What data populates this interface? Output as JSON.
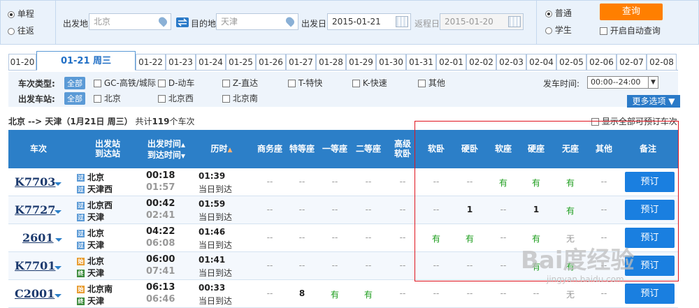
{
  "search": {
    "trip_types": [
      "单程",
      "往返"
    ],
    "from_label": "出发地",
    "from_value": "北京",
    "to_label": "目的地",
    "to_value": "天津",
    "depart_label": "出发日",
    "depart_value": "2015-01-21",
    "return_label": "返程日",
    "return_value": "2015-01-20",
    "passenger_types": [
      "普通",
      "学生"
    ],
    "query_label": "查询",
    "auto_query_label": "开启自动查询"
  },
  "date_tabs": [
    "01-20",
    "01-21 周三",
    "01-22",
    "01-23",
    "01-24",
    "01-25",
    "01-26",
    "01-27",
    "01-28",
    "01-29",
    "01-30",
    "01-31",
    "02-01",
    "02-02",
    "02-03",
    "02-04",
    "02-05",
    "02-06",
    "02-07",
    "02-08"
  ],
  "filters": {
    "type_label": "车次类型:",
    "all_label": "全部",
    "types": [
      "GC-高铁/城际",
      "D-动车",
      "Z-直达",
      "T-特快",
      "K-快速",
      "其他"
    ],
    "station_label": "出发车站:",
    "stations": [
      "北京",
      "北京西",
      "北京南"
    ],
    "time_label": "发车时间:",
    "time_value": "00:00--24:00",
    "more_label": "更多选项"
  },
  "summary": {
    "route": "北京 --> 天津（1月21日  周三）",
    "count_pre": "共计",
    "count": "119",
    "count_post": "个车次",
    "show_all": "显示全部可预订车次"
  },
  "columns": {
    "train": "车次",
    "station1": "出发站",
    "station2": "到达站",
    "time1": "出发时间",
    "time2": "到达时间",
    "duration": "历时",
    "seats": [
      "商务座",
      "特等座",
      "一等座",
      "二等座",
      "高级\n软卧",
      "软卧",
      "硬卧",
      "软座",
      "硬座",
      "无座",
      "其他"
    ],
    "remark": "备注"
  },
  "rows": [
    {
      "no": "K7703",
      "from": "北京",
      "to": "天津西",
      "from_icon": "过",
      "to_icon": "过",
      "dep": "00:18",
      "arr": "01:57",
      "dur": "01:39",
      "day": "当日到达",
      "seats": [
        "--",
        "--",
        "--",
        "--",
        "--",
        "--",
        "--",
        "有",
        "有",
        "有",
        "--"
      ],
      "book": "预订"
    },
    {
      "no": "K7727",
      "from": "北京西",
      "to": "天津",
      "from_icon": "过",
      "to_icon": "过",
      "dep": "00:42",
      "arr": "02:41",
      "dur": "01:59",
      "day": "当日到达",
      "seats": [
        "--",
        "--",
        "--",
        "--",
        "--",
        "--",
        "1",
        "--",
        "1",
        "有",
        "--"
      ],
      "book": "预订"
    },
    {
      "no": "2601",
      "from": "北京",
      "to": "天津",
      "from_icon": "过",
      "to_icon": "过",
      "dep": "04:22",
      "arr": "06:08",
      "dur": "01:46",
      "day": "当日到达",
      "seats": [
        "--",
        "--",
        "--",
        "--",
        "--",
        "有",
        "有",
        "--",
        "有",
        "无",
        "--"
      ],
      "book": "预订"
    },
    {
      "no": "K7701",
      "from": "北京",
      "to": "天津",
      "from_icon": "始",
      "to_icon": "终",
      "dep": "06:00",
      "arr": "07:41",
      "dur": "01:41",
      "day": "当日到达",
      "seats": [
        "--",
        "--",
        "--",
        "--",
        "--",
        "--",
        "--",
        "--",
        "有",
        "有",
        "--"
      ],
      "book": "预订"
    },
    {
      "no": "C2001",
      "from": "北京南",
      "to": "天津",
      "from_icon": "始",
      "to_icon": "终",
      "dep": "06:13",
      "arr": "06:46",
      "dur": "00:33",
      "day": "当日到达",
      "seats": [
        "--",
        "8",
        "有",
        "有",
        "--",
        "--",
        "--",
        "--",
        "--",
        "无",
        "--"
      ],
      "book": "预订"
    }
  ],
  "watermark": {
    "logo": "Bai度经验",
    "url": "jingyan.baidu.com"
  }
}
